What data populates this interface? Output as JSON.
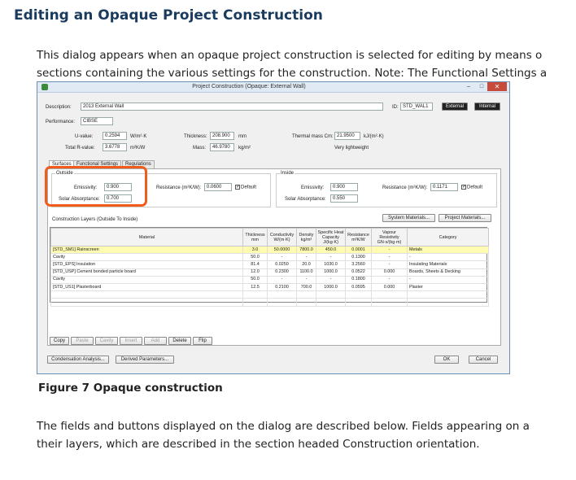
{
  "doc": {
    "title": "Editing an Opaque Project Construction",
    "para1_line1": "This dialog appears when an opaque project construction is selected for editing by means o",
    "para1_line2": "sections containing the various settings for the construction. Note: The Functional Settings a",
    "caption": "Figure 7 Opaque construction",
    "para2_line1": "The fields and buttons displayed on the dialog are described below. Fields appearing on a",
    "para2_line2": "their layers, which are described in the section headed Construction orientation."
  },
  "dialog": {
    "title": "Project Construction (Opaque: External Wall)",
    "minimize": "–",
    "maximize": "□",
    "close": "✕",
    "description_label": "Description:",
    "description_value": "2013 External Wall",
    "id_label": "ID:",
    "id_value": "STD_WAL1",
    "external_label": "External",
    "internal_label": "Internal",
    "performance_label": "Performance:",
    "performance_value": "CIBSE",
    "uvalue_label": "U-value:",
    "uvalue_value": "0.2594",
    "uvalue_unit": "W/m²·K",
    "total_r_label": "Total R-value:",
    "total_r_value": "3.6778",
    "total_r_unit": "m²K/W",
    "thickness_label": "Thickness:",
    "thickness_value": "208.900",
    "thickness_unit": "mm",
    "mass_label": "Mass:",
    "mass_value": "46.9780",
    "mass_unit": "kg/m²",
    "thermal_mass_label": "Thermal mass Cm:",
    "thermal_mass_value": "21.9500",
    "thermal_mass_unit": "kJ/(m²·K)",
    "weight_class": "Very lightweight",
    "tabs": [
      "Surfaces",
      "Functional Settings",
      "Regulations"
    ],
    "outside": {
      "heading": "Outside",
      "emissivity_label": "Emissivity:",
      "emissivity_value": "0.900",
      "solar_label": "Solar Absorptance:",
      "solar_value": "0.700",
      "resistance_label": "Resistance (m²K/W):",
      "resistance_value": "0.0600",
      "default_label": "Default"
    },
    "inside": {
      "heading": "Inside",
      "emissivity_label": "Emissivity:",
      "emissivity_value": "0.900",
      "solar_label": "Solar Absorptance:",
      "solar_value": "0.550",
      "resistance_label": "Resistance (m²K/W):",
      "resistance_value": "0.1171",
      "default_label": "Default"
    },
    "layers_heading": "Construction Layers (Outside To Inside)",
    "system_materials": "System Materials...",
    "project_materials": "Project Materials...",
    "columns": [
      "Material",
      "Thickness mm",
      "Conductivity W/(m·K)",
      "Density kg/m³",
      "Specific Heat Capacity J/(kg·K)",
      "Resistance m²K/W",
      "Vapour Resistivity GN·s/(kg·m)",
      "Category"
    ],
    "rows": [
      [
        "[STD_SM1] Rainscreen",
        "3.0",
        "50.0000",
        "7800.0",
        "450.0",
        "0.0001",
        "-",
        "Metals"
      ],
      [
        "Cavity",
        "50.0",
        "-",
        "-",
        "-",
        "0.1300",
        "-",
        "-"
      ],
      [
        "[STD_EPS] Insulation",
        "81.4",
        "0.0250",
        "20.0",
        "1030.0",
        "3.2560",
        "-",
        "Insulating Materials"
      ],
      [
        "[STD_USP] Cement bonded particle board",
        "12.0",
        "0.2300",
        "1100.0",
        "1000.0",
        "0.0522",
        "0.000",
        "Boards, Sheets & Decking"
      ],
      [
        "Cavity",
        "50.0",
        "-",
        "-",
        "-",
        "0.1800",
        "-",
        "-"
      ],
      [
        "[STD_US1] Plasterboard",
        "12.5",
        "0.2100",
        "700.0",
        "1000.0",
        "0.0595",
        "0.000",
        "Plaster"
      ]
    ],
    "toolbar": [
      "Copy",
      "Paste",
      "Cavity",
      "Insert",
      "Add",
      "Delete",
      "Flip"
    ],
    "condensation": "Condensation Analysis...",
    "derived": "Derived Parameters...",
    "ok": "OK",
    "cancel": "Cancel"
  }
}
